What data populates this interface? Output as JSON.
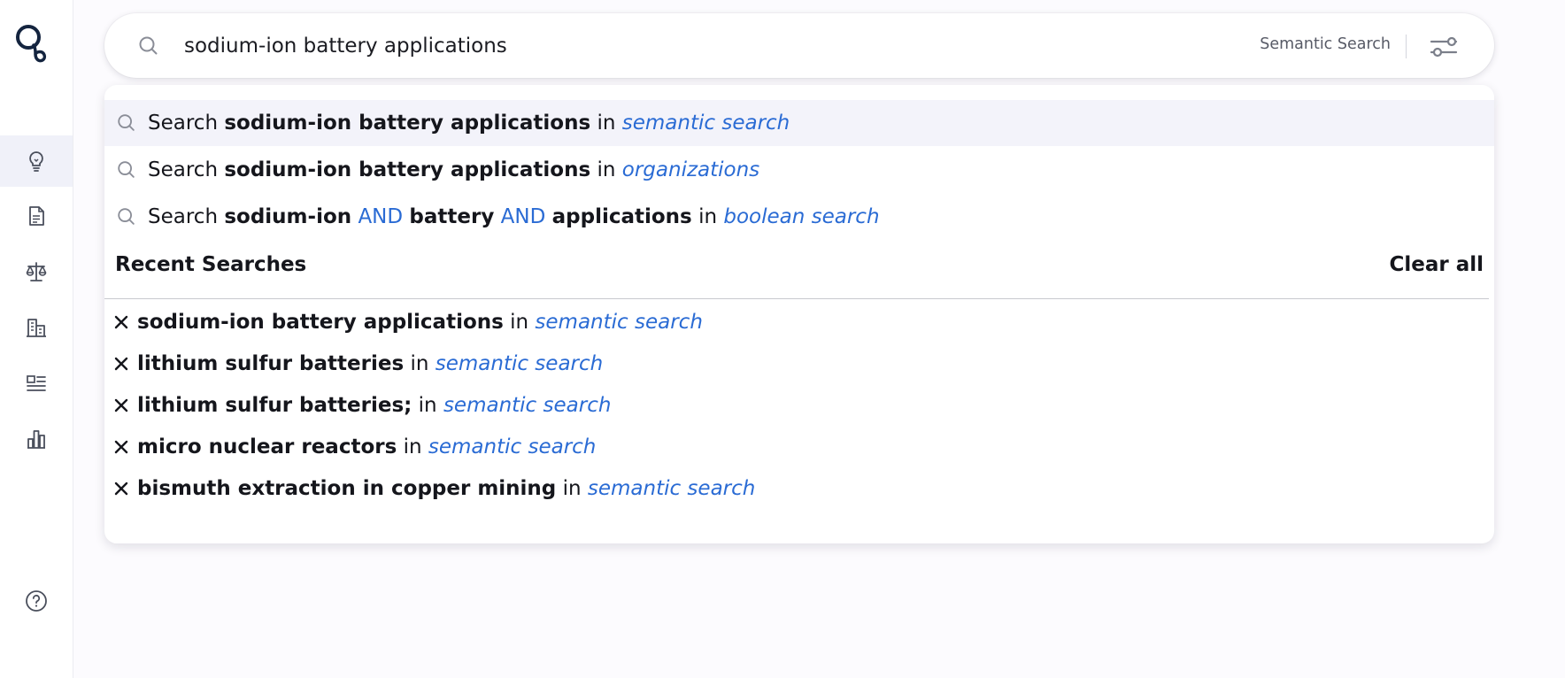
{
  "search": {
    "query": "sodium-ion battery applications",
    "mode_label": "Semantic Search"
  },
  "suggestions": [
    {
      "prefix": "Search",
      "term": "sodium-ion battery applications",
      "in": "in",
      "scope": "semantic search"
    },
    {
      "prefix": "Search",
      "term": "sodium-ion battery applications",
      "in": "in",
      "scope": "organizations"
    },
    {
      "prefix": "Search",
      "terms": [
        "sodium-ion",
        "battery",
        "applications"
      ],
      "operator": "AND",
      "in": "in",
      "scope": "boolean search"
    }
  ],
  "recent": {
    "title": "Recent Searches",
    "clear_label": "Clear all",
    "items": [
      {
        "query": "sodium-ion battery applications",
        "in": "in",
        "scope": "semantic search"
      },
      {
        "query": "lithium sulfur batteries",
        "in": "in",
        "scope": "semantic search"
      },
      {
        "query": "lithium sulfur batteries;",
        "in": "in",
        "scope": "semantic search"
      },
      {
        "query": "micro nuclear reactors",
        "in": "in",
        "scope": "semantic search"
      },
      {
        "query": "bismuth extraction in copper mining",
        "in": "in",
        "scope": "semantic search"
      }
    ]
  },
  "sidebar": {
    "icons": [
      "lightbulb-icon",
      "document-icon",
      "scales-icon",
      "building-icon",
      "news-icon",
      "bar-chart-icon"
    ],
    "help_icon": "help-icon"
  },
  "colors": {
    "accent": "#2a6bd4",
    "brand": "#14243f",
    "active_nav_bg": "#f0f1f9",
    "highlight_row": "#f3f3fa"
  }
}
